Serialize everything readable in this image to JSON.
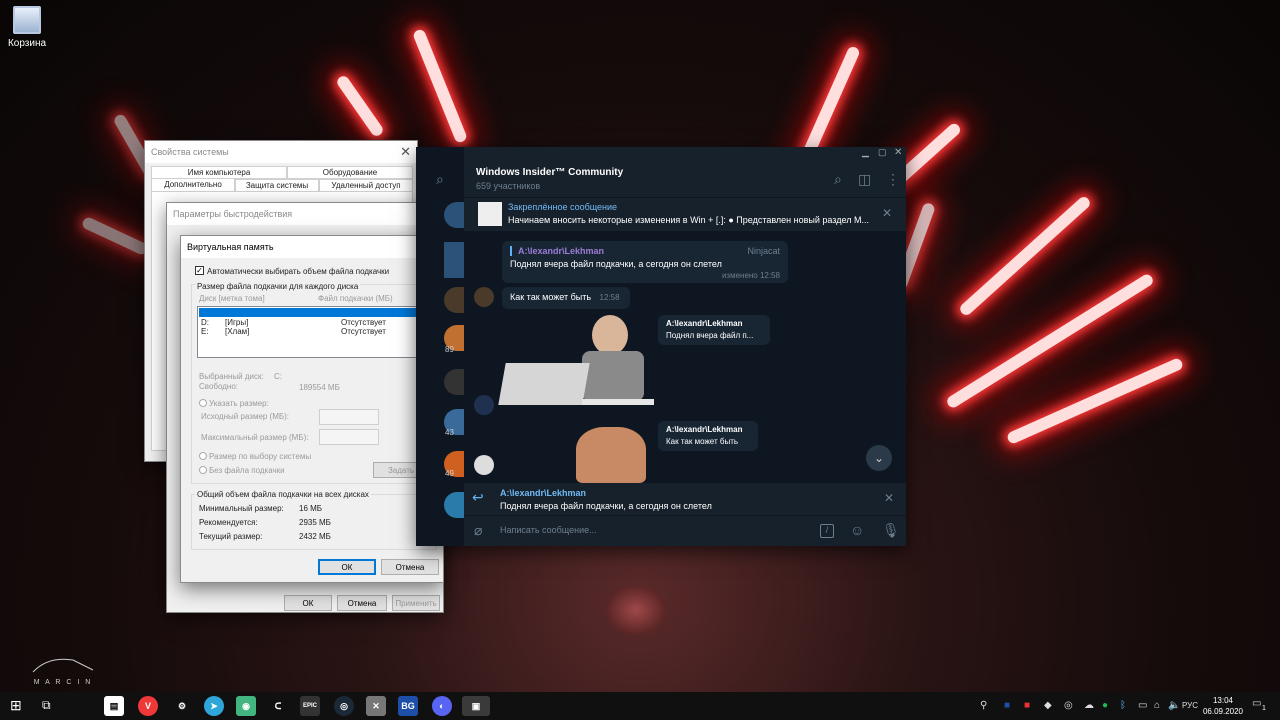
{
  "desktop": {
    "recycle_bin": "Корзина",
    "logo_text": "M A R C I N"
  },
  "sys_props": {
    "title": "Свойства системы",
    "tabs_row1": [
      "Имя компьютера",
      "Оборудование"
    ],
    "tabs_row2": [
      "Дополнительно",
      "Защита системы",
      "Удаленный доступ"
    ]
  },
  "perf": {
    "title": "Параметры быстродействия",
    "ok": "ОК",
    "cancel": "Отмена",
    "apply": "Применить"
  },
  "vm": {
    "title": "Виртуальная память",
    "auto_checkbox": "Автоматически выбирать объем файла подкачки",
    "group_title": "Размер файла подкачки для каждого диска",
    "col_disk": "Диск [метка тома]",
    "col_size": "Файл подкачки (МБ)",
    "drives": [
      {
        "disk": "",
        "label": "",
        "size": ""
      },
      {
        "disk": "D:",
        "label": "[Игры]",
        "size": "Отсутствует"
      },
      {
        "disk": "E:",
        "label": "[Хлам]",
        "size": "Отсутствует"
      }
    ],
    "selected_disk_label": "Выбранный диск:",
    "selected_disk": "C:",
    "free_label": "Свободно:",
    "free_value": "189554 МБ",
    "custom_size": "Указать размер:",
    "initial_size": "Исходный размер (МБ):",
    "max_size": "Максимальный размер (МБ):",
    "system_managed": "Размер по выбору системы",
    "no_paging": "Без файла подкачки",
    "set_btn": "Задать",
    "total_title": "Общий объем файла подкачки на всех дисках",
    "min_label": "Минимальный размер:",
    "min_value": "16 МБ",
    "rec_label": "Рекомендуется:",
    "rec_value": "2935 МБ",
    "cur_label": "Текущий размер:",
    "cur_value": "2432 МБ",
    "ok": "ОК",
    "cancel": "Отмена"
  },
  "telegram": {
    "chat_title": "Windows Insider™ Community",
    "members": "659 участников",
    "pinned_label": "Закреплённое сообщение",
    "pinned_text": "Начинаем вносить некоторые изменения в Win + [.]: ● Представлен новый раздел М...",
    "msg1": {
      "quote_name": "A:\\lexandr\\Lekhman",
      "sender": "Ninjacat",
      "text": "Поднял вчера файл подкачки, а сегодня он слетел",
      "meta": "изменено 12:58"
    },
    "msg2": {
      "text": "Как так может быть",
      "time": "12:58"
    },
    "reply1": {
      "name": "A:\\lexandr\\Lekhman",
      "text": "Поднял вчера файл п..."
    },
    "reply2": {
      "name": "A:\\lexandr\\Lekhman",
      "text": "Как так может быть"
    },
    "reply_bar": {
      "name": "A:\\lexandr\\Lekhman",
      "text": "Поднял вчера файл подкачки, а сегодня он слетел"
    },
    "input_placeholder": "Написать сообщение...",
    "side_badges": [
      "89",
      "43",
      "49"
    ]
  },
  "taskbar": {
    "apps": [
      "EPIC",
      "BG"
    ],
    "lang": "РУС",
    "time": "13:04",
    "date": "06.09.2020",
    "notif_count": "1"
  },
  "colors": {
    "accent": "#0078d7",
    "tg_bg": "#17212b",
    "tg_link": "#71baf5"
  }
}
